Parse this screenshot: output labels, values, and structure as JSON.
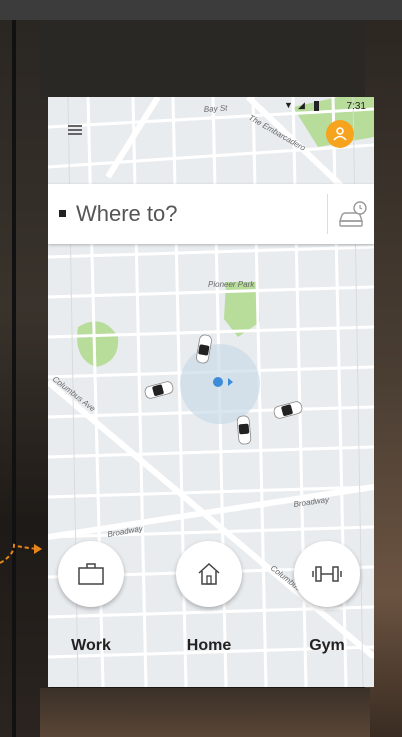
{
  "status_bar": {
    "time": "7:31"
  },
  "map": {
    "street_labels": [
      "Bay St",
      "The Embarcadero",
      "Pioneer Park",
      "Columbus Ave",
      "Broadway",
      "Broadway",
      "Columbus Ave"
    ]
  },
  "search": {
    "placeholder": "Where to?"
  },
  "shortcuts": [
    {
      "label": "Work",
      "icon": "briefcase-icon"
    },
    {
      "label": "Home",
      "icon": "home-icon"
    },
    {
      "label": "Gym",
      "icon": "dumbbell-icon"
    }
  ],
  "colors": {
    "avatar": "#f6a41e",
    "park": "#b8dc9a",
    "location_dot": "#3d8bd9",
    "annotation_arrow": "#e8861a"
  }
}
